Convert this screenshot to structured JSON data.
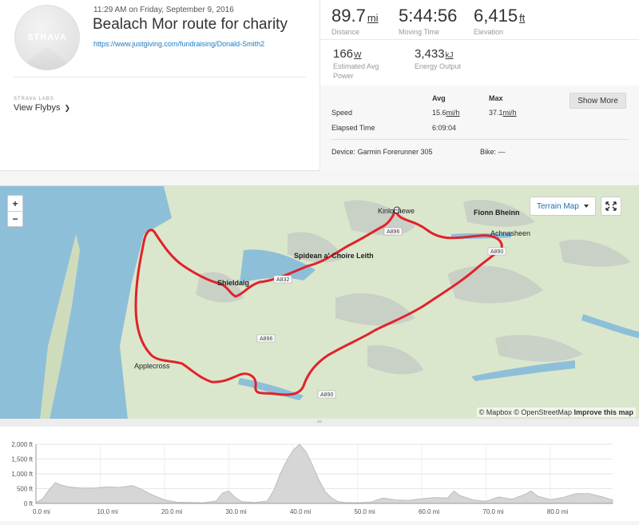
{
  "activity": {
    "date": "11:29 AM on Friday, September 9, 2016",
    "title": "Bealach Mor route for charity",
    "link": "https://www.justgiving.com/fundraising/Donald-Smith2",
    "avatar_logo": "STRAVA"
  },
  "labs": {
    "heading": "STRAVA LABS",
    "flybys": "View Flybys",
    "flybys_icon": "chevron-right-icon"
  },
  "stats": {
    "distance": {
      "value": "89.7",
      "unit": "mi",
      "label": "Distance"
    },
    "moving_time": {
      "value": "5:44:56",
      "label": "Moving Time"
    },
    "elevation": {
      "value": "6,415",
      "unit": "ft",
      "label": "Elevation"
    },
    "power": {
      "value": "166",
      "unit": "W",
      "label": "Estimated Avg Power"
    },
    "energy": {
      "value": "3,433",
      "unit": "kJ",
      "label": "Energy Output"
    }
  },
  "detail": {
    "avg_header": "Avg",
    "max_header": "Max",
    "show_more": "Show More",
    "speed_label": "Speed",
    "speed_avg": "15.6",
    "speed_max": "37.1",
    "speed_unit": "mi/h",
    "elapsed_label": "Elapsed Time",
    "elapsed_value": "6:09:04",
    "device": "Device: Garmin Forerunner 305",
    "bike": "Bike: —"
  },
  "map": {
    "zoom_in": "+",
    "zoom_out": "−",
    "map_type": "Terrain Map",
    "attribution_1": "© Mapbox © OpenStreetMap",
    "attribution_2": "Improve this map",
    "labels": [
      "Kinlochewe",
      "Fionn Bheinn",
      "Achnasheen",
      "Spidean a' Choire Leith",
      "Shieldaig",
      "Applecross",
      "A896",
      "A890",
      "A896",
      "A832",
      "A890"
    ],
    "route_color": "#e0232b"
  },
  "chart_data": {
    "type": "area",
    "xlabel": "",
    "ylabel": "",
    "x_ticks": [
      "0.0 mi",
      "10.0 mi",
      "20.0 mi",
      "30.0 mi",
      "40.0 mi",
      "50.0 mi",
      "60.0 mi",
      "70.0 mi",
      "80.0 mi"
    ],
    "y_ticks": [
      "0 ft",
      "500 ft",
      "1,000 ft",
      "1,500 ft",
      "2,000 ft"
    ],
    "xlim": [
      0,
      89.7
    ],
    "ylim": [
      0,
      2000
    ],
    "series": [
      {
        "x": [
          0,
          1,
          2,
          3,
          4,
          5,
          7,
          9,
          11,
          13,
          15,
          16,
          18,
          20,
          22,
          24,
          26,
          28,
          29,
          30,
          31,
          32,
          34,
          36,
          37,
          38,
          39,
          40,
          41,
          42,
          43,
          44,
          45,
          46,
          47,
          48,
          50,
          52,
          54,
          56,
          58,
          60,
          62,
          64,
          65,
          66,
          68,
          70,
          72,
          74,
          76,
          77,
          78,
          80,
          82,
          84,
          86,
          88,
          89.7
        ],
        "y": [
          30,
          150,
          450,
          700,
          620,
          560,
          520,
          520,
          560,
          540,
          600,
          520,
          300,
          120,
          40,
          30,
          20,
          80,
          350,
          420,
          200,
          60,
          30,
          80,
          450,
          1000,
          1450,
          1800,
          2000,
          1750,
          1300,
          800,
          400,
          180,
          60,
          30,
          20,
          40,
          180,
          120,
          100,
          160,
          200,
          180,
          420,
          260,
          120,
          70,
          220,
          140,
          300,
          420,
          250,
          130,
          200,
          330,
          330,
          230,
          120
        ]
      }
    ]
  }
}
